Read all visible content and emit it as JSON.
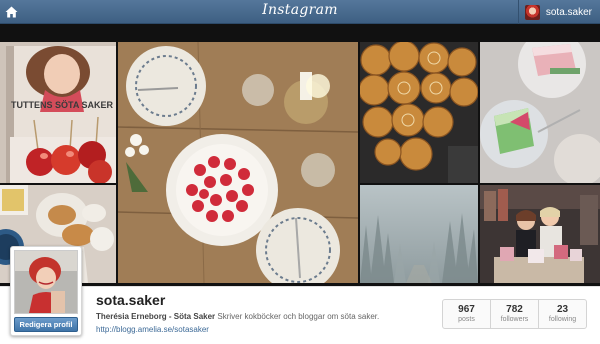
{
  "app": {
    "name": "Instagram"
  },
  "header": {
    "home_icon": "home-icon",
    "logo_text": "Instagram",
    "username": "sota.saker"
  },
  "photos": [
    {
      "id": "book-cover",
      "cover_text": "TUTTENS SÖTA SAKER"
    },
    {
      "id": "strawberry-cake-table"
    },
    {
      "id": "cinnamon-buns"
    },
    {
      "id": "cake-slices"
    },
    {
      "id": "coffee-pastries"
    },
    {
      "id": "misty-forest"
    },
    {
      "id": "book-signing"
    }
  ],
  "profile": {
    "username": "sota.saker",
    "full_name": "Therésia Erneborg - Söta Saker",
    "bio": "Skriver kokböcker och bloggar om söta saker.",
    "website": "http://blogg.amelia.se/sotasaker",
    "edit_button": "Redigera profil"
  },
  "stats": [
    {
      "value": "967",
      "label": "posts"
    },
    {
      "value": "782",
      "label": "followers"
    },
    {
      "value": "23",
      "label": "following"
    }
  ]
}
